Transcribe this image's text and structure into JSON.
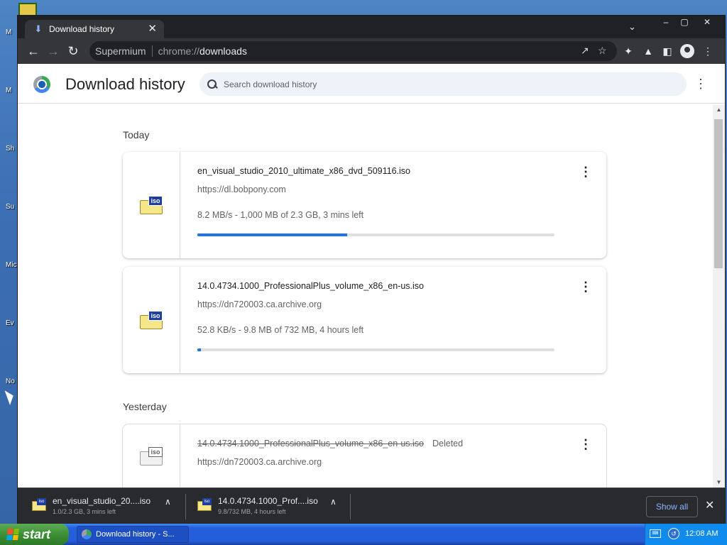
{
  "desktop": {
    "icon_labels": [
      "M",
      "M",
      "Sh",
      "Su",
      "Micr",
      "Ev",
      "No"
    ]
  },
  "browser": {
    "tab": {
      "title": "Download history"
    },
    "omnibox": {
      "site": "Supermium",
      "scheme": "chrome://",
      "path": "downloads"
    }
  },
  "page": {
    "title": "Download history",
    "search_placeholder": "Search download history",
    "groups": [
      {
        "date": "Today",
        "items": [
          {
            "name": "en_visual_studio_2010_ultimate_x86_dvd_509116.iso",
            "url": "https://dl.bobpony.com",
            "progress_text": "8.2 MB/s - 1,000 MB of 2.3 GB, 3 mins left",
            "progress": 0.42
          },
          {
            "name": "14.0.4734.1000_ProfessionalPlus_volume_x86_en-us.iso",
            "url": "https://dn720003.ca.archive.org",
            "progress_text": "52.8 KB/s - 9.8 MB of 732 MB, 4 hours left",
            "progress": 0.01
          }
        ]
      },
      {
        "date": "Yesterday",
        "items": [
          {
            "name": "14.0.4734.1000_ProfessionalPlus_volume_x86_en-us.iso",
            "status": "Deleted",
            "url": "https://dn720003.ca.archive.org"
          }
        ]
      }
    ],
    "file_type_tag": "iso"
  },
  "shelf": {
    "items": [
      {
        "name": "en_visual_studio_20....iso",
        "sub": "1.0/2.3 GB, 3 mins left"
      },
      {
        "name": "14.0.4734.1000_Prof....iso",
        "sub": "9.8/732 MB, 4 hours left"
      }
    ],
    "show_all": "Show all"
  },
  "taskbar": {
    "start": "start",
    "task_title": "Download history - S...",
    "clock": "12:08 AM"
  },
  "colors": {
    "accent": "#1a73e8",
    "taskbar": "#245edb",
    "start": "#3c8f35"
  }
}
